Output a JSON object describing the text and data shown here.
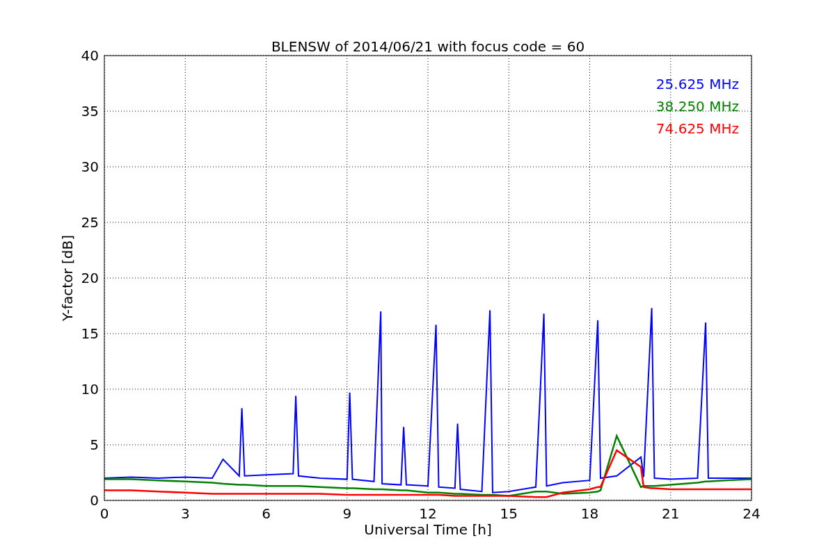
{
  "chart_data": {
    "type": "line",
    "title": "BLENSW of 2014/06/21 with focus code = 60",
    "xlabel": "Universal Time [h]",
    "ylabel": "Y-factor [dB]",
    "x": [
      0,
      1,
      2,
      3,
      4,
      4.4,
      5,
      5.1,
      5.2,
      6,
      7,
      7.1,
      7.2,
      8,
      9,
      9.1,
      9.2,
      10,
      10.25,
      10.3,
      11,
      11.1,
      11.2,
      12,
      12.3,
      12.4,
      13,
      13.1,
      13.2,
      14,
      14.3,
      14.4,
      15,
      16,
      16.3,
      16.4,
      17,
      18,
      18.3,
      18.4,
      19,
      19.9,
      20,
      20.3,
      20.4,
      21,
      22,
      22.3,
      22.4,
      23,
      24
    ],
    "series": [
      {
        "name": "25.625 MHz",
        "color": "#0000ff",
        "values": [
          2,
          2.1,
          2,
          2.1,
          2,
          3.7,
          2.2,
          8.3,
          2.2,
          2.3,
          2.4,
          9.4,
          2.2,
          2,
          1.9,
          9.7,
          1.9,
          1.7,
          17,
          1.5,
          1.4,
          6.6,
          1.4,
          1.3,
          15.8,
          1.2,
          1.1,
          6.9,
          1,
          0.8,
          17.1,
          0.7,
          0.8,
          1.2,
          16.8,
          1.3,
          1.6,
          1.8,
          16.2,
          2,
          2.2,
          3.9,
          2.1,
          17.3,
          2,
          1.9,
          2,
          16,
          2,
          2,
          2
        ]
      },
      {
        "name": "38.250 MHz",
        "color": "#008000",
        "values": [
          1.9,
          1.9,
          1.8,
          1.7,
          1.6,
          1.5,
          1.4,
          1.4,
          1.4,
          1.3,
          1.3,
          1.3,
          1.3,
          1.2,
          1.1,
          1.1,
          1.1,
          1,
          1,
          1,
          0.9,
          0.9,
          0.9,
          0.7,
          0.7,
          0.7,
          0.6,
          0.6,
          0.6,
          0.5,
          0.5,
          0.5,
          0.4,
          0.8,
          0.8,
          0.8,
          0.6,
          0.7,
          0.8,
          0.9,
          5.8,
          1.2,
          1.3,
          1.3,
          1.3,
          1.4,
          1.6,
          1.7,
          1.7,
          1.8,
          1.9
        ]
      },
      {
        "name": "74.625 MHz",
        "color": "#ff0000",
        "values": [
          0.9,
          0.9,
          0.8,
          0.7,
          0.6,
          0.6,
          0.6,
          0.6,
          0.6,
          0.6,
          0.6,
          0.6,
          0.6,
          0.6,
          0.5,
          0.5,
          0.5,
          0.5,
          0.5,
          0.5,
          0.5,
          0.5,
          0.5,
          0.5,
          0.5,
          0.5,
          0.4,
          0.4,
          0.4,
          0.4,
          0.4,
          0.4,
          0.4,
          0.3,
          0.3,
          0.3,
          0.7,
          1,
          1.2,
          1.2,
          4.5,
          3,
          1.2,
          1.1,
          1.1,
          1,
          1,
          1,
          1,
          1,
          1
        ]
      }
    ],
    "grid": true,
    "xlim": [
      0,
      24
    ],
    "ylim": [
      0,
      40
    ],
    "xticks": [
      0,
      3,
      6,
      9,
      12,
      15,
      18,
      21,
      24
    ],
    "yticks": [
      0,
      5,
      10,
      15,
      20,
      25,
      30,
      35,
      40
    ]
  }
}
